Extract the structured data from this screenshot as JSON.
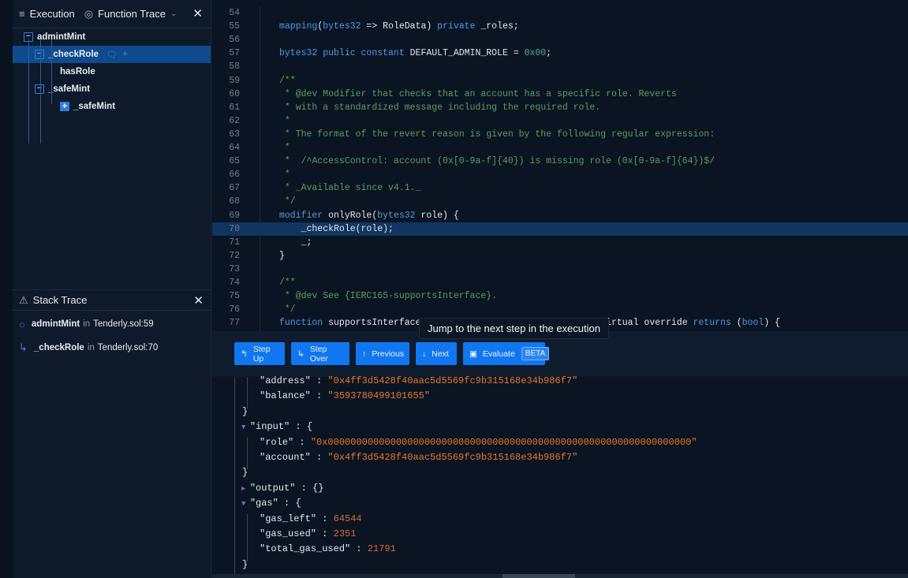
{
  "left": {
    "tabs": [
      {
        "label": "Execution",
        "icon": "list-icon"
      },
      {
        "label": "Function Trace",
        "icon": "target-icon"
      }
    ],
    "tree": [
      {
        "label": "admintMint",
        "state": "expanded",
        "depth": 0
      },
      {
        "label": "_checkRole",
        "state": "expanded",
        "depth": 1,
        "selected": true
      },
      {
        "label": "hasRole",
        "state": "leaf",
        "depth": 2
      },
      {
        "label": "_safeMint",
        "state": "expanded",
        "depth": 1
      },
      {
        "label": "_safeMint",
        "state": "collapsed",
        "depth": 2
      }
    ],
    "stack": {
      "title": "Stack Trace",
      "items": [
        {
          "fn": "admintMint",
          "in": "in",
          "loc": "Tenderly.sol:59"
        },
        {
          "fn": "_checkRole",
          "in": "in",
          "loc": "Tenderly.sol:70"
        }
      ]
    }
  },
  "code": {
    "highlight_line": 70,
    "lines": [
      {
        "n": 54,
        "t": []
      },
      {
        "n": 55,
        "t": [
          [
            "kw",
            "mapping"
          ],
          [
            "pl",
            "("
          ],
          [
            "kw",
            "bytes32"
          ],
          [
            "pl",
            " => RoleData) "
          ],
          [
            "kw",
            "private"
          ],
          [
            "pl",
            " _roles;"
          ]
        ]
      },
      {
        "n": 56,
        "t": []
      },
      {
        "n": 57,
        "t": [
          [
            "kw",
            "bytes32 public constant"
          ],
          [
            "pl",
            " DEFAULT_ADMIN_ROLE = "
          ],
          [
            "nm",
            "0x00"
          ],
          [
            "pl",
            ";"
          ]
        ]
      },
      {
        "n": 58,
        "t": []
      },
      {
        "n": 59,
        "t": [
          [
            "cm",
            "/**"
          ]
        ]
      },
      {
        "n": 60,
        "t": [
          [
            "cm",
            " * @dev Modifier that checks that an account has a specific role. Reverts"
          ]
        ]
      },
      {
        "n": 61,
        "t": [
          [
            "cm",
            " * with a standardized message including the required role."
          ]
        ]
      },
      {
        "n": 62,
        "t": [
          [
            "cm",
            " *"
          ]
        ]
      },
      {
        "n": 63,
        "t": [
          [
            "cm",
            " * The format of the revert reason is given by the following regular expression:"
          ]
        ]
      },
      {
        "n": 64,
        "t": [
          [
            "cm",
            " *"
          ]
        ]
      },
      {
        "n": 65,
        "t": [
          [
            "cm",
            " *  /^AccessControl: account (0x[0-9a-f]{40}) is missing role (0x[0-9a-f]{64})$/"
          ]
        ]
      },
      {
        "n": 66,
        "t": [
          [
            "cm",
            " *"
          ]
        ]
      },
      {
        "n": 67,
        "t": [
          [
            "cm",
            " * _Available since v4.1._"
          ]
        ]
      },
      {
        "n": 68,
        "t": [
          [
            "cm",
            " */"
          ]
        ]
      },
      {
        "n": 69,
        "t": [
          [
            "kw",
            "modifier"
          ],
          [
            "pl",
            " onlyRole("
          ],
          [
            "kw",
            "bytes32"
          ],
          [
            "pl",
            " role) {"
          ]
        ]
      },
      {
        "n": 70,
        "t": [
          [
            "pl",
            "    _checkRole(role);"
          ]
        ]
      },
      {
        "n": 71,
        "t": [
          [
            "pl",
            "    _;"
          ]
        ]
      },
      {
        "n": 72,
        "t": [
          [
            "pl",
            "}"
          ]
        ]
      },
      {
        "n": 73,
        "t": []
      },
      {
        "n": 74,
        "t": [
          [
            "cm",
            "/**"
          ]
        ]
      },
      {
        "n": 75,
        "t": [
          [
            "cm",
            " * @dev See {IERC165-supportsInterface}."
          ]
        ]
      },
      {
        "n": 76,
        "t": [
          [
            "cm",
            " */"
          ]
        ]
      },
      {
        "n": 77,
        "t": [
          [
            "kw",
            "function"
          ],
          [
            "pl",
            " supportsInterface(bytes4 interfaceId) public view virtual override "
          ],
          [
            "kw",
            "returns"
          ],
          [
            "pl",
            " ("
          ],
          [
            "kw",
            "bool"
          ],
          [
            "pl",
            ") {"
          ]
        ]
      }
    ]
  },
  "tooltip": "Jump to the next step in the execution",
  "toolbar": [
    {
      "label": "Step Up",
      "icon": "step-up-icon",
      "glyph": "↰"
    },
    {
      "label": "Step Over",
      "icon": "step-over-icon",
      "glyph": "↳"
    },
    {
      "label": "Previous",
      "icon": "arrow-up-icon",
      "glyph": "↑"
    },
    {
      "label": "Next",
      "icon": "arrow-down-icon",
      "glyph": "↓"
    },
    {
      "label": "Evaluate",
      "icon": "calculator-icon",
      "glyph": "▣",
      "badge": "BETA"
    }
  ],
  "json": [
    {
      "i": 2,
      "k": "\"address\"",
      "v": "\"0x4ff3d5428f40aac5d5569fc9b315168e34b986f7\"",
      "vt": "str"
    },
    {
      "i": 2,
      "k": "\"balance\"",
      "v": "\"3593780499101655\"",
      "vt": "str"
    },
    {
      "i": 1,
      "k": "}"
    },
    {
      "i": 1,
      "tri": "open",
      "k": "\"input\"",
      "v": "{",
      "vt": "pl"
    },
    {
      "i": 2,
      "k": "\"role\"",
      "v": "\"0x0000000000000000000000000000000000000000000000000000000000000000\"",
      "vt": "str"
    },
    {
      "i": 2,
      "k": "\"account\"",
      "v": "\"0x4ff3d5428f40aac5d5569fc9b315168e34b986f7\"",
      "vt": "str"
    },
    {
      "i": 1,
      "k": "}"
    },
    {
      "i": 1,
      "tri": "closed",
      "k": "\"output\"",
      "v": "{}",
      "vt": "pl"
    },
    {
      "i": 1,
      "tri": "open",
      "k": "\"gas\"",
      "v": "{",
      "vt": "pl"
    },
    {
      "i": 2,
      "k": "\"gas_left\"",
      "v": "64544",
      "vt": "n2"
    },
    {
      "i": 2,
      "k": "\"gas_used\"",
      "v": "2351",
      "vt": "n2"
    },
    {
      "i": 2,
      "k": "\"total_gas_used\"",
      "v": "21791",
      "vt": "n2"
    },
    {
      "i": 1,
      "k": "}"
    }
  ]
}
